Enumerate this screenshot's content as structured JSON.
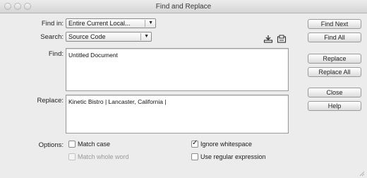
{
  "window": {
    "title": "Find and Replace"
  },
  "find_in": {
    "label": "Find in:",
    "value": "Entire Current Local..."
  },
  "search": {
    "label": "Search:",
    "value": "Source Code"
  },
  "find": {
    "label": "Find:",
    "value": "Untitled Document"
  },
  "replace": {
    "label": "Replace:",
    "value": "Kinetic Bistro | Lancaster, California |"
  },
  "buttons": {
    "find_next": "Find Next",
    "find_all": "Find All",
    "replace": "Replace",
    "replace_all": "Replace All",
    "close": "Close",
    "help": "Help"
  },
  "options": {
    "label": "Options:",
    "match_case": {
      "label": "Match case",
      "checked": false,
      "enabled": true
    },
    "match_whole_word": {
      "label": "Match whole word",
      "checked": false,
      "enabled": false
    },
    "ignore_whitespace": {
      "label": "Ignore whitespace",
      "checked": true,
      "enabled": true
    },
    "use_regex": {
      "label": "Use regular expression",
      "checked": false,
      "enabled": true
    }
  }
}
